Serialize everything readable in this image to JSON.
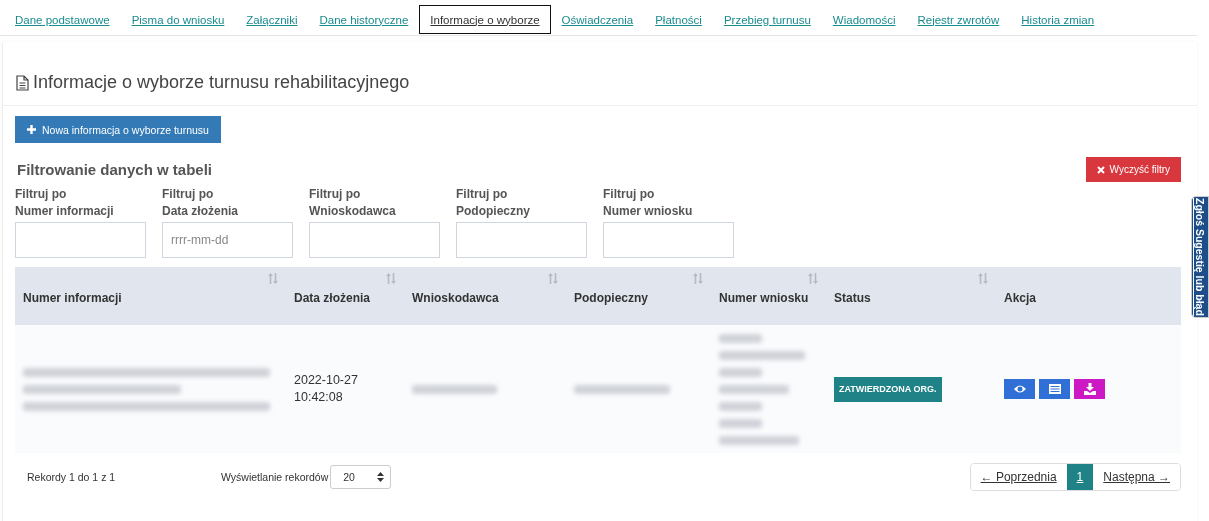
{
  "tabs": [
    {
      "label": "Dane podstawowe",
      "selected": false
    },
    {
      "label": "Pisma do wniosku",
      "selected": false
    },
    {
      "label": "Załączniki",
      "selected": false
    },
    {
      "label": "Dane historyczne",
      "selected": false
    },
    {
      "label": "Informacje o wyborze",
      "selected": true
    },
    {
      "label": "Oświadczenia",
      "selected": false
    },
    {
      "label": "Płatności",
      "selected": false
    },
    {
      "label": "Przebieg turnusu",
      "selected": false
    },
    {
      "label": "Wiadomości",
      "selected": false
    },
    {
      "label": "Rejestr zwrotów",
      "selected": false
    },
    {
      "label": "Historia zmian",
      "selected": false
    }
  ],
  "page_title": "Informacje o wyborze turnusu rehabilitacyjnego",
  "new_button": "Nowa informacja o wyborze turnusu",
  "filter_title": "Filtrowanie danych w tabeli",
  "clear_button": "Wyczyść filtry",
  "filters": [
    {
      "label_1": "Filtruj po",
      "label_2": "Numer informacji"
    },
    {
      "label_1": "Filtruj po",
      "label_2": "Data złożenia",
      "placeholder": "rrrr-mm-dd"
    },
    {
      "label_1": "Filtruj po",
      "label_2": "Wnioskodawca"
    },
    {
      "label_1": "Filtruj po",
      "label_2": "Podopieczny"
    },
    {
      "label_1": "Filtruj po",
      "label_2": "Numer wniosku"
    }
  ],
  "table": {
    "columns": [
      {
        "label": "Numer informacji",
        "sortable": true
      },
      {
        "label": "Data złożenia",
        "sortable": true
      },
      {
        "label": "Wnioskodawca",
        "sortable": true
      },
      {
        "label": "Podopieczny",
        "sortable": true
      },
      {
        "label": "Numer wniosku",
        "sortable": true
      },
      {
        "label": "Status",
        "sortable": true
      },
      {
        "label": "Akcja",
        "sortable": false
      }
    ],
    "rows": [
      {
        "cells": [
          {
            "kind": "redacted"
          },
          {
            "kind": "text",
            "lines": [
              "2022-10-27",
              "10:42:08"
            ]
          },
          {
            "kind": "redacted"
          },
          {
            "kind": "redacted"
          },
          {
            "kind": "redacted"
          },
          {
            "kind": "badge",
            "text": "ZATWIERDZONA ORG."
          },
          {
            "kind": "actions",
            "actions": [
              {
                "kind": "view",
                "color": "#2f6fd6"
              },
              {
                "kind": "details",
                "color": "#2f6fd6"
              },
              {
                "kind": "download",
                "color": "#cc19c4"
              }
            ]
          }
        ]
      }
    ]
  },
  "records_info": "Rekordy 1 do 1 z 1",
  "page_size_label": "Wyświetlanie rekordów",
  "page_size": "20",
  "pagination": [
    {
      "label": "← Poprzednia",
      "selected": false
    },
    {
      "label": "1",
      "selected": true
    },
    {
      "label": "Następna →",
      "selected": false
    }
  ],
  "side_tab": "Zgłoś Sugestię lub błąd"
}
